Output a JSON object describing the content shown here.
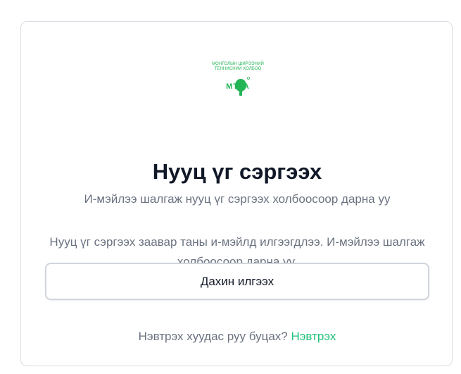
{
  "logo": {
    "line1": "МОНГОЛЫН ШИРЭЭНИЙ",
    "line2": "ТЕННИСНИЙ ХОЛБОО",
    "abbr": "MTTA",
    "color": "#22b455"
  },
  "page": {
    "title": "Нууц үг сэргээх",
    "subtitle": "И-мэйлээ шалгаж нууц үг сэргээх холбоосоор дарна уу",
    "message": "Нууц үг сэргээх заавар таны и-мэйлд илгээгдлээ. И-мэйлээ шалгаж холбоосоор дарна уу.",
    "resend_label": "Дахин илгээх"
  },
  "footer": {
    "prompt": "Нэвтрэх хуудас руу буцах?",
    "login_link": "Нэвтрэх",
    "link_color": "#22c07a"
  }
}
